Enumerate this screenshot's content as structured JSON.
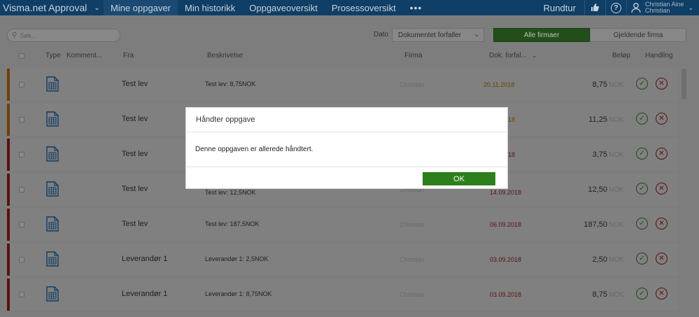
{
  "nav": {
    "app_title": "Visma.net Approval",
    "tabs": [
      {
        "label": "Mine oppgaver"
      },
      {
        "label": "Min historikk"
      },
      {
        "label": "Oppgaveoversikt"
      },
      {
        "label": "Prosessoversikt"
      }
    ],
    "more_label": "•••",
    "rundtur_label": "Rundtur",
    "help_glyph": "?",
    "user_name": "Christian Aine",
    "user_sub": "Christian",
    "icons": [
      "chevron-down-icon",
      "thumbs-icon",
      "help-icon",
      "user-icon"
    ]
  },
  "filters": {
    "search_placeholder": "Søk...",
    "dato_label": "Dato",
    "dato_value": "Dokumentet forfaller",
    "seg_all": "Alle firmaer",
    "seg_current": "Gjeldende firma"
  },
  "columns": {
    "type": "Type",
    "komment": "Komment...",
    "fra": "Fra",
    "beskrivelse": "Beskrivelse",
    "firma": "Firma",
    "dok": "Dok. forfal...",
    "belop": "Beløp",
    "handling": "Handling"
  },
  "rows": [
    {
      "fra": "Test lev",
      "beskrivelse": "Test lev: 8,75NOK",
      "firma": "Christian",
      "dato": "20.11.2018",
      "belop": "8,75",
      "valuta": "NOK"
    },
    {
      "fra": "Test lev",
      "beskrivelse": "",
      "firma": "",
      "dato": "18",
      "belop": "11,25",
      "valuta": "NOK"
    },
    {
      "fra": "Test lev",
      "beskrivelse": "",
      "firma": "",
      "dato": "18",
      "belop": "3,75",
      "valuta": "NOK"
    },
    {
      "fra": "Test lev",
      "beskrivelse": "Test lev: 12,5NOK",
      "firma": "Christian",
      "dato": "14.09.2018",
      "belop": "12,50",
      "valuta": "NOK"
    },
    {
      "fra": "Test lev",
      "beskrivelse": "Test lev: 187,5NOK",
      "firma": "Christian",
      "dato": "06.09.2018",
      "belop": "187,50",
      "valuta": "NOK"
    },
    {
      "fra": "Leverandør 1",
      "beskrivelse": "Leverandør 1: 2,5NOK",
      "firma": "Christian",
      "dato": "03.09.2018",
      "belop": "2,50",
      "valuta": "NOK"
    },
    {
      "fra": "Leverandør 1",
      "beskrivelse": "Leverandør 1: 8,75NOK",
      "firma": "Christian",
      "dato": "03.09.2018",
      "belop": "8,75",
      "valuta": "NOK"
    }
  ],
  "colors": {
    "status_orange": "#7a5200",
    "status_red": "#5a1010",
    "accent_green": "#2d7f1d",
    "nav_bg": "#0f3e66"
  },
  "dialog": {
    "title": "Håndter oppgave",
    "message": "Denne oppgaven er allerede håndtert.",
    "ok_label": "OK"
  }
}
